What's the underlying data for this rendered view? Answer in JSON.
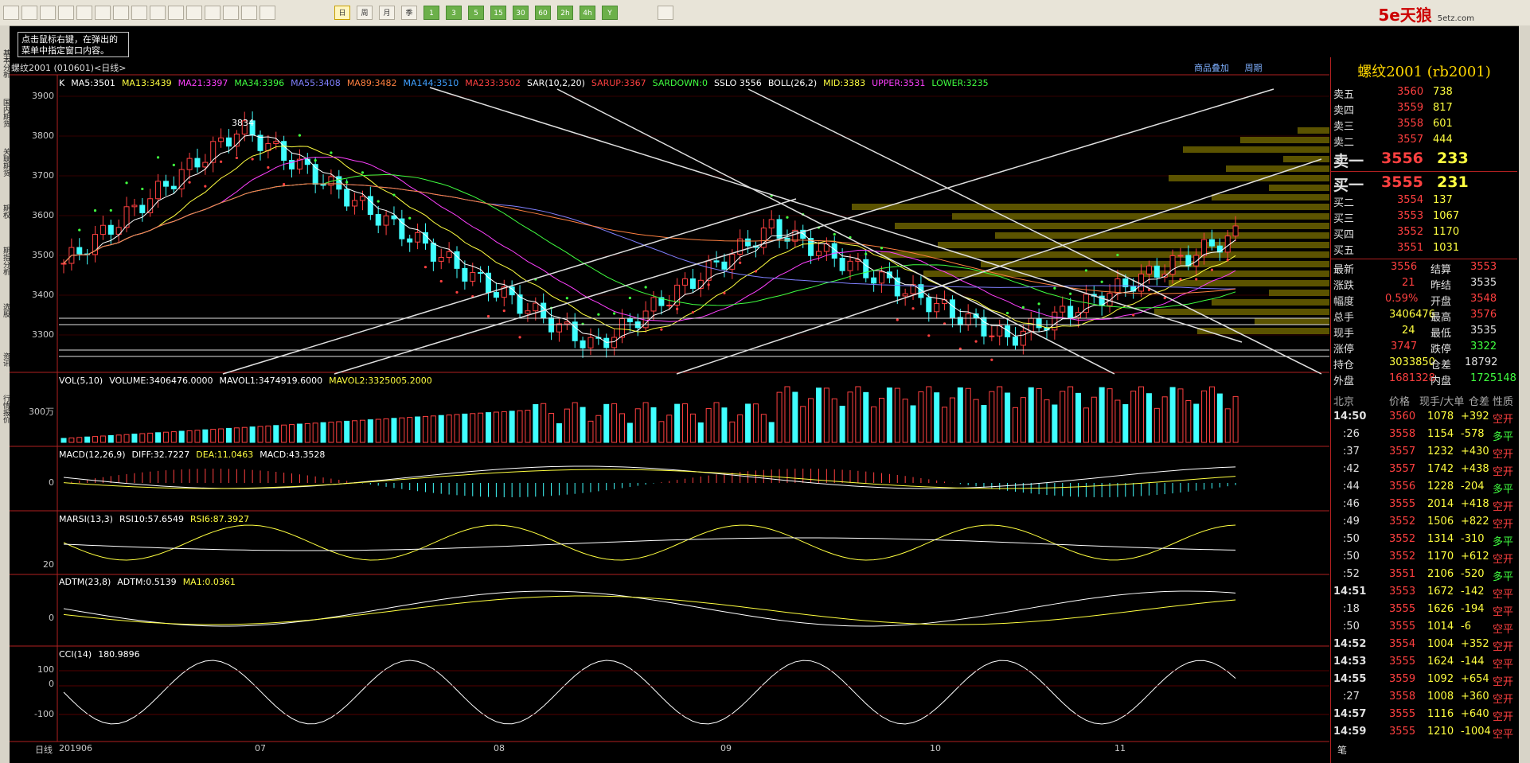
{
  "toolbar": {
    "buttons": [
      "back-icon",
      "home-icon",
      "folder-icon",
      "card-icon",
      "refresh-icon",
      "zoom-in-icon",
      "zoom-out-icon",
      "window-icon",
      "pen-icon",
      "brush-icon",
      "filter-icon",
      "news-icon",
      "table-icon",
      "chart-icon",
      "kline-icon"
    ],
    "periods": [
      "日",
      "周",
      "月",
      "季",
      "1",
      "3",
      "5",
      "15",
      "30",
      "60",
      "2h",
      "4h",
      "Y"
    ]
  },
  "logo": {
    "brand": "5e天狼",
    "domain": "5etz.com"
  },
  "tooltip": {
    "line1": "点击鼠标右键，在弹出的",
    "line2": "菜单中指定窗口内容。"
  },
  "left_tabs": [
    "基本分析",
    "国内期货",
    "关联期货",
    "期权",
    "期指分析",
    "选股",
    "资讯",
    "行情报价"
  ],
  "chart": {
    "title": "螺纹2001 (010601)<日线>",
    "links": [
      "商品叠加",
      "周期"
    ],
    "ma_header": [
      {
        "t": "K",
        "c": "#ffffff"
      },
      {
        "t": "MA5:3501",
        "c": "#ffffff"
      },
      {
        "t": "MA13:3439",
        "c": "#ffff40"
      },
      {
        "t": "MA21:3397",
        "c": "#ff40ff"
      },
      {
        "t": "MA34:3396",
        "c": "#40ff40"
      },
      {
        "t": "MA55:3408",
        "c": "#8080ff"
      },
      {
        "t": "MA89:3482",
        "c": "#ff8040"
      },
      {
        "t": "MA144:3510",
        "c": "#40a0ff"
      },
      {
        "t": "MA233:3502",
        "c": "#ff4040"
      },
      {
        "t": "SAR(10,2,20)",
        "c": "#ffffff"
      },
      {
        "t": "SARUP:3367",
        "c": "#ff4040"
      },
      {
        "t": "SARDOWN:0",
        "c": "#40ff40"
      },
      {
        "t": "SSLO 3556",
        "c": "#ffffff"
      },
      {
        "t": "BOLL(26,2)",
        "c": "#ffffff"
      },
      {
        "t": "MID:3383",
        "c": "#ffff40"
      },
      {
        "t": "UPPER:3531",
        "c": "#ff40ff"
      },
      {
        "t": "LOWER:3235",
        "c": "#40ff40"
      }
    ],
    "price_axis": [
      "3900",
      "3800",
      "3700",
      "3600",
      "3500",
      "3400",
      "3300"
    ],
    "peak_label": "3834",
    "vol_header": [
      {
        "t": "VOL(5,10)",
        "c": "#ffffff"
      },
      {
        "t": "VOLUME:3406476.0000",
        "c": "#ffffff"
      },
      {
        "t": "MAVOL1:3474919.6000",
        "c": "#ffffff"
      },
      {
        "t": "MAVOL2:3325005.2000",
        "c": "#ffff40"
      }
    ],
    "vol_axis": "300万",
    "macd_header": [
      {
        "t": "MACD(12,26,9)",
        "c": "#ffffff"
      },
      {
        "t": "DIFF:32.7227",
        "c": "#ffffff"
      },
      {
        "t": "DEA:11.0463",
        "c": "#ffff40"
      },
      {
        "t": "MACD:43.3528",
        "c": "#ffffff"
      }
    ],
    "macd_axis": "0",
    "marsi_header": [
      {
        "t": "MARSI(13,3)",
        "c": "#ffffff"
      },
      {
        "t": "RSI10:57.6549",
        "c": "#ffffff"
      },
      {
        "t": "RSI6:87.3927",
        "c": "#ffff40"
      }
    ],
    "marsi_axis": "20",
    "adtm_header": [
      {
        "t": "ADTM(23,8)",
        "c": "#ffffff"
      },
      {
        "t": "ADTM:0.5139",
        "c": "#ffffff"
      },
      {
        "t": "MA1:0.0361",
        "c": "#ffff40"
      }
    ],
    "adtm_axis": "0",
    "cci_header": [
      {
        "t": "CCI(14)",
        "c": "#ffffff"
      },
      {
        "t": "180.9896",
        "c": "#ffffff"
      }
    ],
    "cci_axis": [
      "100",
      "0",
      "-100"
    ],
    "x_axis": [
      "日线",
      "201906",
      "07",
      "08",
      "09",
      "10",
      "11"
    ]
  },
  "quote": {
    "title": "螺纹2001 (rb2001)",
    "asks": [
      [
        "卖五",
        "3560",
        "738"
      ],
      [
        "卖四",
        "3559",
        "817"
      ],
      [
        "卖三",
        "3558",
        "601"
      ],
      [
        "卖二",
        "3557",
        "444"
      ],
      [
        "卖一",
        "3556",
        "233"
      ]
    ],
    "bids": [
      [
        "买一",
        "3555",
        "231"
      ],
      [
        "买二",
        "3554",
        "137"
      ],
      [
        "买三",
        "3553",
        "1067"
      ],
      [
        "买四",
        "3552",
        "1170"
      ],
      [
        "买五",
        "3551",
        "1031"
      ]
    ],
    "stats": [
      [
        "最新",
        "3556",
        "结算",
        "3553"
      ],
      [
        "涨跌",
        "21",
        "昨结",
        "3535"
      ],
      [
        "幅度",
        "0.59%",
        "开盘",
        "3548"
      ],
      [
        "总手",
        "3406476",
        "最高",
        "3576"
      ],
      [
        "现手",
        "24",
        "最低",
        "3535"
      ],
      [
        "涨停",
        "3747",
        "跌停",
        "3322"
      ],
      [
        "持仓",
        "3033850",
        "仓差",
        "18792"
      ],
      [
        "外盘",
        "1681328",
        "内盘",
        "1725148"
      ]
    ],
    "tick_header": [
      "北京",
      "价格",
      "现手/大单",
      "仓差",
      "性质"
    ],
    "ticks": [
      [
        "14:50",
        "3560",
        "1078",
        "+392",
        "空开"
      ],
      [
        ":26",
        "3558",
        "1154",
        "-578",
        "多平"
      ],
      [
        ":37",
        "3557",
        "1232",
        "+430",
        "空开"
      ],
      [
        ":42",
        "3557",
        "1742",
        "+438",
        "空开"
      ],
      [
        ":44",
        "3556",
        "1228",
        "-204",
        "多平"
      ],
      [
        ":46",
        "3555",
        "2014",
        "+418",
        "空开"
      ],
      [
        ":49",
        "3552",
        "1506",
        "+822",
        "空开"
      ],
      [
        ":50",
        "3552",
        "1314",
        "-310",
        "多平"
      ],
      [
        ":50",
        "3552",
        "1170",
        "+612",
        "空开"
      ],
      [
        ":52",
        "3551",
        "2106",
        "-520",
        "多平"
      ],
      [
        "14:51",
        "3553",
        "1672",
        "-142",
        "空平"
      ],
      [
        ":18",
        "3555",
        "1626",
        "-194",
        "空平"
      ],
      [
        ":50",
        "3555",
        "1014",
        "-6",
        "空平"
      ],
      [
        "14:52",
        "3554",
        "1004",
        "+352",
        "空开"
      ],
      [
        "14:53",
        "3555",
        "1624",
        "-144",
        "空平"
      ],
      [
        "14:55",
        "3559",
        "1092",
        "+654",
        "空开"
      ],
      [
        ":27",
        "3558",
        "1008",
        "+360",
        "空开"
      ],
      [
        "14:57",
        "3555",
        "1116",
        "+640",
        "空开"
      ],
      [
        "14:59",
        "3555",
        "1210",
        "-1004",
        "空平"
      ]
    ],
    "footer_tab": "笔"
  },
  "colors": {
    "up": "#ff4040",
    "down": "#40ffff",
    "border": "#b02020",
    "bg": "#000000"
  }
}
